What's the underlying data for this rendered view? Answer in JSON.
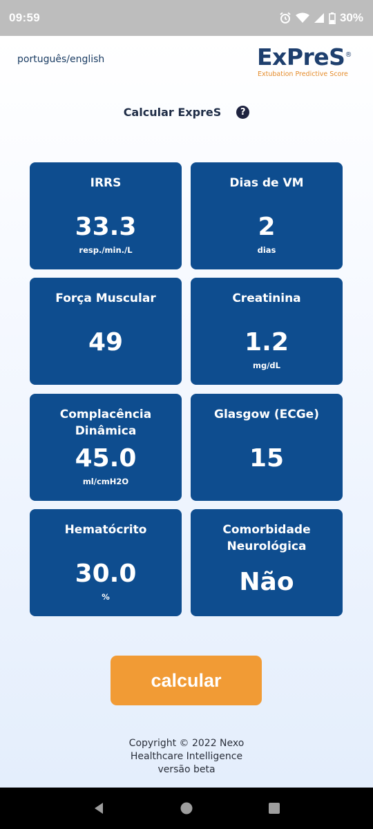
{
  "status_bar": {
    "time": "09:59",
    "battery": "30%"
  },
  "header": {
    "language_link": "português/english",
    "logo_title": "ExPreS",
    "logo_reg": "®",
    "logo_subtitle": "Extubation Predictive Score"
  },
  "title": {
    "text": "Calcular ExpreS",
    "help_symbol": "?"
  },
  "cards": [
    {
      "label": "IRRS",
      "value": "33.3",
      "unit": "resp./min./L"
    },
    {
      "label": "Dias de VM",
      "value": "2",
      "unit": "dias"
    },
    {
      "label": "Força Muscular",
      "value": "49",
      "unit": ""
    },
    {
      "label": "Creatinina",
      "value": "1.2",
      "unit": "mg/dL"
    },
    {
      "label": "Complacência Dinâmica",
      "value": "45.0",
      "unit": "ml/cmH2O"
    },
    {
      "label": "Glasgow (ECGe)",
      "value": "15",
      "unit": ""
    },
    {
      "label": "Hematócrito",
      "value": "30.0",
      "unit": "%"
    },
    {
      "label": "Comorbidade Neurológica",
      "value": "Não",
      "unit": ""
    }
  ],
  "button": {
    "label": "calcular"
  },
  "footer": {
    "line1": "Copyright © 2022 Nexo",
    "line2": "Healthcare Intelligence",
    "line3": "versão beta"
  },
  "icons": {
    "status": [
      "alarm-icon",
      "wifi-icon",
      "signal-icon",
      "battery-icon"
    ],
    "nav": [
      "back-icon",
      "home-icon",
      "recents-icon"
    ]
  },
  "colors": {
    "card": "#0e4d8f",
    "button": "#f19b35",
    "logo": "#1e3f6e",
    "logo_sub": "#e58b2a"
  }
}
